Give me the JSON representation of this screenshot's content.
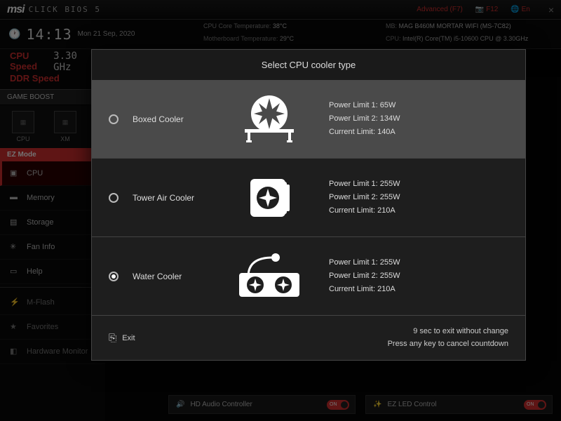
{
  "brand": {
    "badge": "msi",
    "product": "CLICK BIOS 5"
  },
  "top": {
    "advanced": "Advanced (F7)",
    "screenshot": "F12",
    "lang": "En",
    "close": "×"
  },
  "clock": {
    "time": "14:13",
    "date": "Mon  21 Sep, 2020"
  },
  "sys": {
    "cpu_temp_lbl": "CPU Core Temperature:",
    "cpu_temp": "38°C",
    "mb_lbl": "MB:",
    "mb": "MAG B460M MORTAR WIFI (MS-7C82)",
    "mobo_temp_lbl": "Motherboard Temperature:",
    "mobo_temp": "29°C",
    "cpu_lbl": "CPU:",
    "cpu": "Intel(R) Core(TM) i5-10600 CPU @ 3.30GHz"
  },
  "speeds": {
    "cpu_lbl": "CPU Speed",
    "cpu_val": "3.30 GHz",
    "ddr_lbl": "DDR Speed"
  },
  "game_boost": "GAME BOOST",
  "chips": {
    "cpu": "CPU",
    "xmp": "XM"
  },
  "ez_mode": "EZ Mode",
  "nav": {
    "cpu": "CPU",
    "memory": "Memory",
    "storage": "Storage",
    "fan": "Fan Info",
    "help": "Help",
    "mflash": "M-Flash",
    "fav": "Favorites",
    "hwmon": "Hardware Monitor"
  },
  "toggles": {
    "audio": "HD Audio Controller",
    "led": "EZ LED Control",
    "on": "ON"
  },
  "modal": {
    "title": "Select CPU cooler type",
    "options": [
      {
        "label": "Boxed Cooler",
        "pl1": "Power Limit 1: 65W",
        "pl2": "Power Limit 2: 134W",
        "cl": "Current Limit: 140A"
      },
      {
        "label": "Tower Air Cooler",
        "pl1": "Power Limit 1: 255W",
        "pl2": "Power Limit 2: 255W",
        "cl": "Current Limit: 210A"
      },
      {
        "label": "Water Cooler",
        "pl1": "Power Limit 1: 255W",
        "pl2": "Power Limit 2: 255W",
        "cl": "Current Limit: 210A"
      }
    ],
    "exit": "Exit",
    "countdown": "9  sec to exit without change",
    "hint": "Press any key to cancel countdown"
  }
}
